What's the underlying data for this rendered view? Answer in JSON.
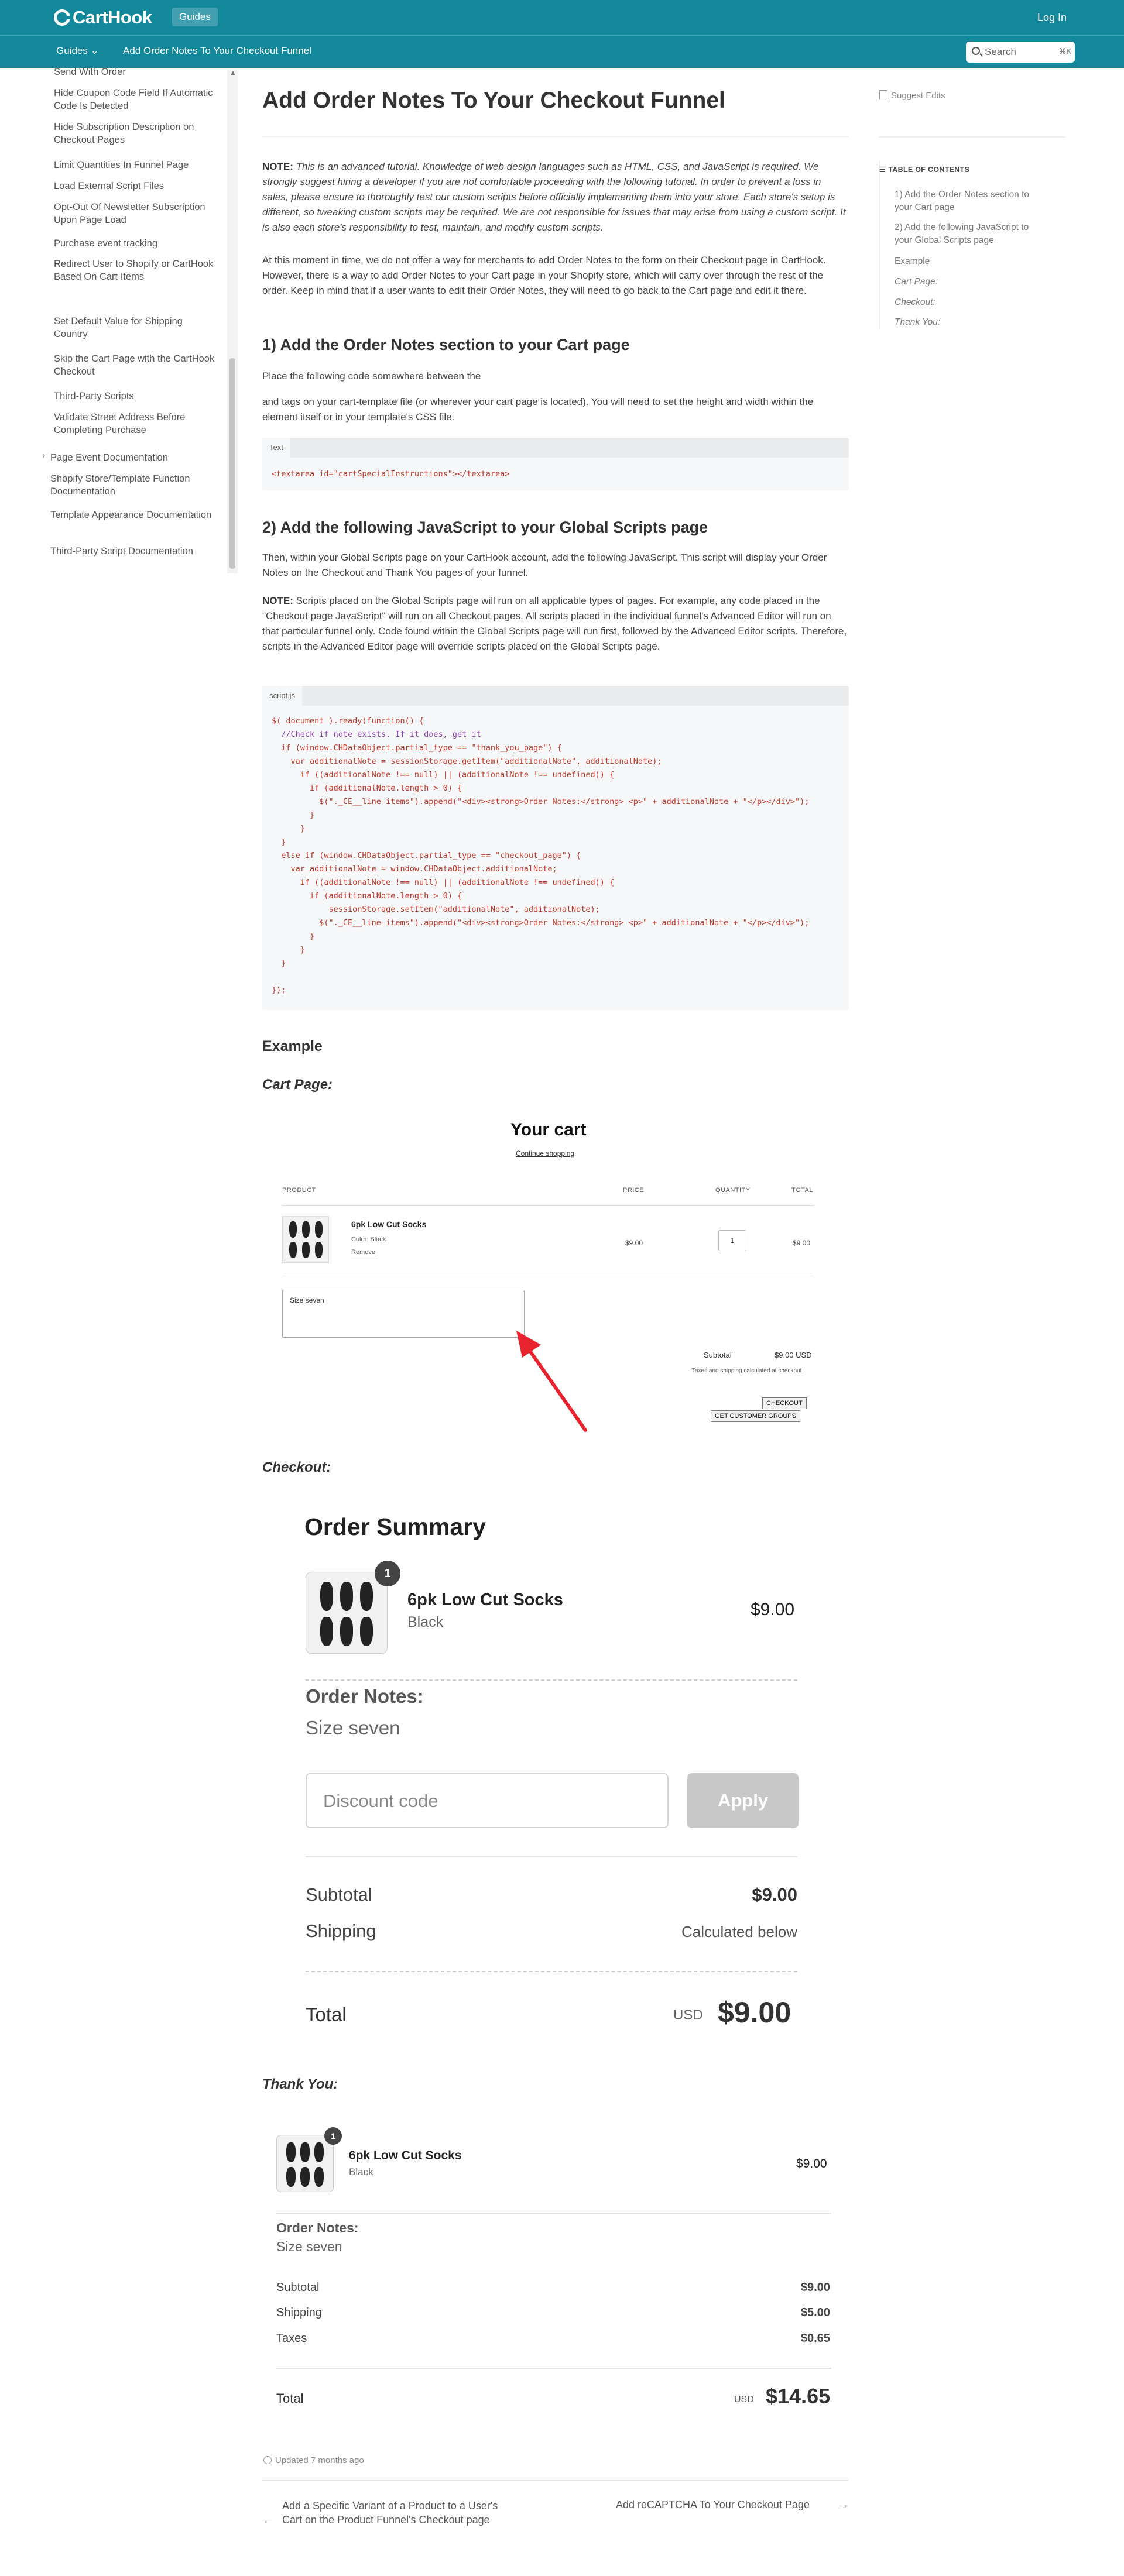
{
  "header": {
    "logo": "CartHook",
    "badge": "Guides",
    "login": "Log In",
    "nav_guides": "Guides",
    "nav_title": "Add Order Notes To Your Checkout Funnel",
    "search_placeholder": "Search",
    "search_kbd": "⌘K"
  },
  "sidebar": {
    "items": [
      "Send With Order",
      "Hide Coupon Code Field If Automatic Code Is Detected",
      "Hide Subscription Description on Checkout Pages",
      "Limit Quantities In Funnel Page",
      "Load External Script Files",
      "Opt-Out Of Newsletter Subscription Upon Page Load",
      "Purchase event tracking",
      "Redirect User to Shopify or CartHook Based On Cart Items",
      "Set Default Value for Shipping Country",
      "Skip the Cart Page with the CartHook Checkout",
      "Third-Party Scripts",
      "Validate Street Address Before Completing Purchase"
    ],
    "top_items": [
      "Page Event Documentation",
      "Shopify Store/Template Function Documentation",
      "Template Appearance Documentation",
      "Third-Party Script Documentation"
    ]
  },
  "article": {
    "title": "Add Order Notes To Your Checkout Funnel",
    "suggest_edits": "Suggest Edits",
    "note_label": "NOTE:",
    "note_text": "This is an advanced tutorial. Knowledge of web design languages such as HTML, CSS, and JavaScript is required. We strongly suggest hiring a developer if you are not comfortable proceeding with the following tutorial. In order to prevent a loss in sales, please ensure to thoroughly test our custom scripts before officially implementing them into your store. Each store's setup is different, so tweaking custom scripts may be required. We are not responsible for issues that may arise from using a custom script. It is also each store's responsibility to test, maintain, and modify custom scripts.",
    "intro": "At this moment in time, we do not offer a way for merchants to add Order Notes to the form on their Checkout page in CartHook. However, there is a way to add Order Notes to your Cart page in your Shopify store, which will carry over through the rest of the order. Keep in mind that if a user wants to edit their Order Notes, they will need to go back to the Cart page and edit it there.",
    "h1": "1) Add the Order Notes section to your Cart page",
    "h1_p1": "Place the following code somewhere between the",
    "h1_p2": "and tags on your cart-template file (or wherever your cart page is located). You will need to set the height and width within the element itself or in your template's CSS file.",
    "code1_tab": "Text",
    "code1": "<textarea id=\"cartSpecialInstructions\"></textarea>",
    "h2": "2) Add the following JavaScript to your Global Scripts page",
    "h2_p1": "Then, within your Global Scripts page on your CartHook account, add the following JavaScript. This script will display your Order Notes on the Checkout and Thank You pages of your funnel.",
    "note2_label": "NOTE:",
    "note2_text": "Scripts placed on the Global Scripts page will run on all applicable types of pages. For example, any code placed in the \"Checkout page JavaScript\" will run on all Checkout pages. All scripts placed in the individual funnel's Advanced Editor will run on that particular funnel only. Code found within the Global Scripts page will run first, followed by the Advanced Editor scripts. Therefore, scripts in the Advanced Editor page will override scripts placed on the Global Scripts page.",
    "code2_tab": "script.js",
    "code2_lines": [
      "$( document ).ready(function() {",
      "  //Check if note exists. If it does, get it",
      "  if (window.CHDataObject.partial_type == \"thank_you_page\") {",
      "    var additionalNote = sessionStorage.getItem(\"additionalNote\", additionalNote);",
      "      if ((additionalNote !== null) || (additionalNote !== undefined)) {",
      "        if (additionalNote.length > 0) {",
      "          $(\"._CE__line-items\").append(\"<div><strong>Order Notes:</strong> <p>\" + additionalNote + \"</p></div>\");",
      "        }",
      "      }",
      "  }",
      "  else if (window.CHDataObject.partial_type == \"checkout_page\") {",
      "    var additionalNote = window.CHDataObject.additionalNote;",
      "      if ((additionalNote !== null) || (additionalNote !== undefined)) {",
      "        if (additionalNote.length > 0) {",
      "            sessionStorage.setItem(\"additionalNote\", additionalNote);",
      "          $(\"._CE__line-items\").append(\"<div><strong>Order Notes:</strong> <p>\" + additionalNote + \"</p></div>\");",
      "        }",
      "      }",
      "  }",
      "",
      "});"
    ],
    "example": "Example",
    "cart_page": "Cart Page:",
    "checkout": "Checkout:",
    "thank_you": "Thank You:",
    "updated": "Updated 7 months ago"
  },
  "toc": {
    "heading": "TABLE OF CONTENTS",
    "items": [
      "1) Add the Order Notes section to your Cart page",
      "2) Add the following JavaScript to your Global Scripts page",
      "Example",
      "Cart Page:",
      "Checkout:",
      "Thank You:"
    ]
  },
  "cart": {
    "title": "Your cart",
    "continue": "Continue shopping",
    "col_product": "PRODUCT",
    "col_price": "PRICE",
    "col_quantity": "QUANTITY",
    "col_total": "TOTAL",
    "item_name": "6pk Low Cut Socks",
    "item_color": "Color: Black",
    "remove": "Remove",
    "price": "$9.00",
    "qty": "1",
    "total": "$9.00",
    "note": "Size seven",
    "subtotal_label": "Subtotal",
    "subtotal": "$9.00 USD",
    "taxes_note": "Taxes and shipping calculated at checkout",
    "checkout_btn": "CHECKOUT",
    "groups_btn": "GET CUSTOMER GROUPS"
  },
  "checkout_summary": {
    "title": "Order Summary",
    "badge": "1",
    "item_name": "6pk Low Cut Socks",
    "item_color": "Black",
    "item_price": "$9.00",
    "notes_label": "Order Notes:",
    "notes_value": "Size seven",
    "discount_placeholder": "Discount code",
    "apply": "Apply",
    "subtotal_label": "Subtotal",
    "subtotal": "$9.00",
    "shipping_label": "Shipping",
    "shipping": "Calculated below",
    "total_label": "Total",
    "currency": "USD",
    "total": "$9.00"
  },
  "thank_you": {
    "badge": "1",
    "item_name": "6pk Low Cut Socks",
    "item_color": "Black",
    "item_price": "$9.00",
    "notes_label": "Order Notes:",
    "notes_value": "Size seven",
    "subtotal_label": "Subtotal",
    "subtotal": "$9.00",
    "shipping_label": "Shipping",
    "shipping": "$5.00",
    "taxes_label": "Taxes",
    "taxes": "$0.65",
    "total_label": "Total",
    "currency": "USD",
    "total": "$14.65"
  },
  "footer_nav": {
    "prev": "Add a Specific Variant of a Product to a User's Cart on the Product Funnel's Checkout page",
    "next": "Add reCAPTCHA To Your Checkout Page"
  },
  "colors": {
    "header": "#13889b",
    "arrow": "#e8232d"
  }
}
